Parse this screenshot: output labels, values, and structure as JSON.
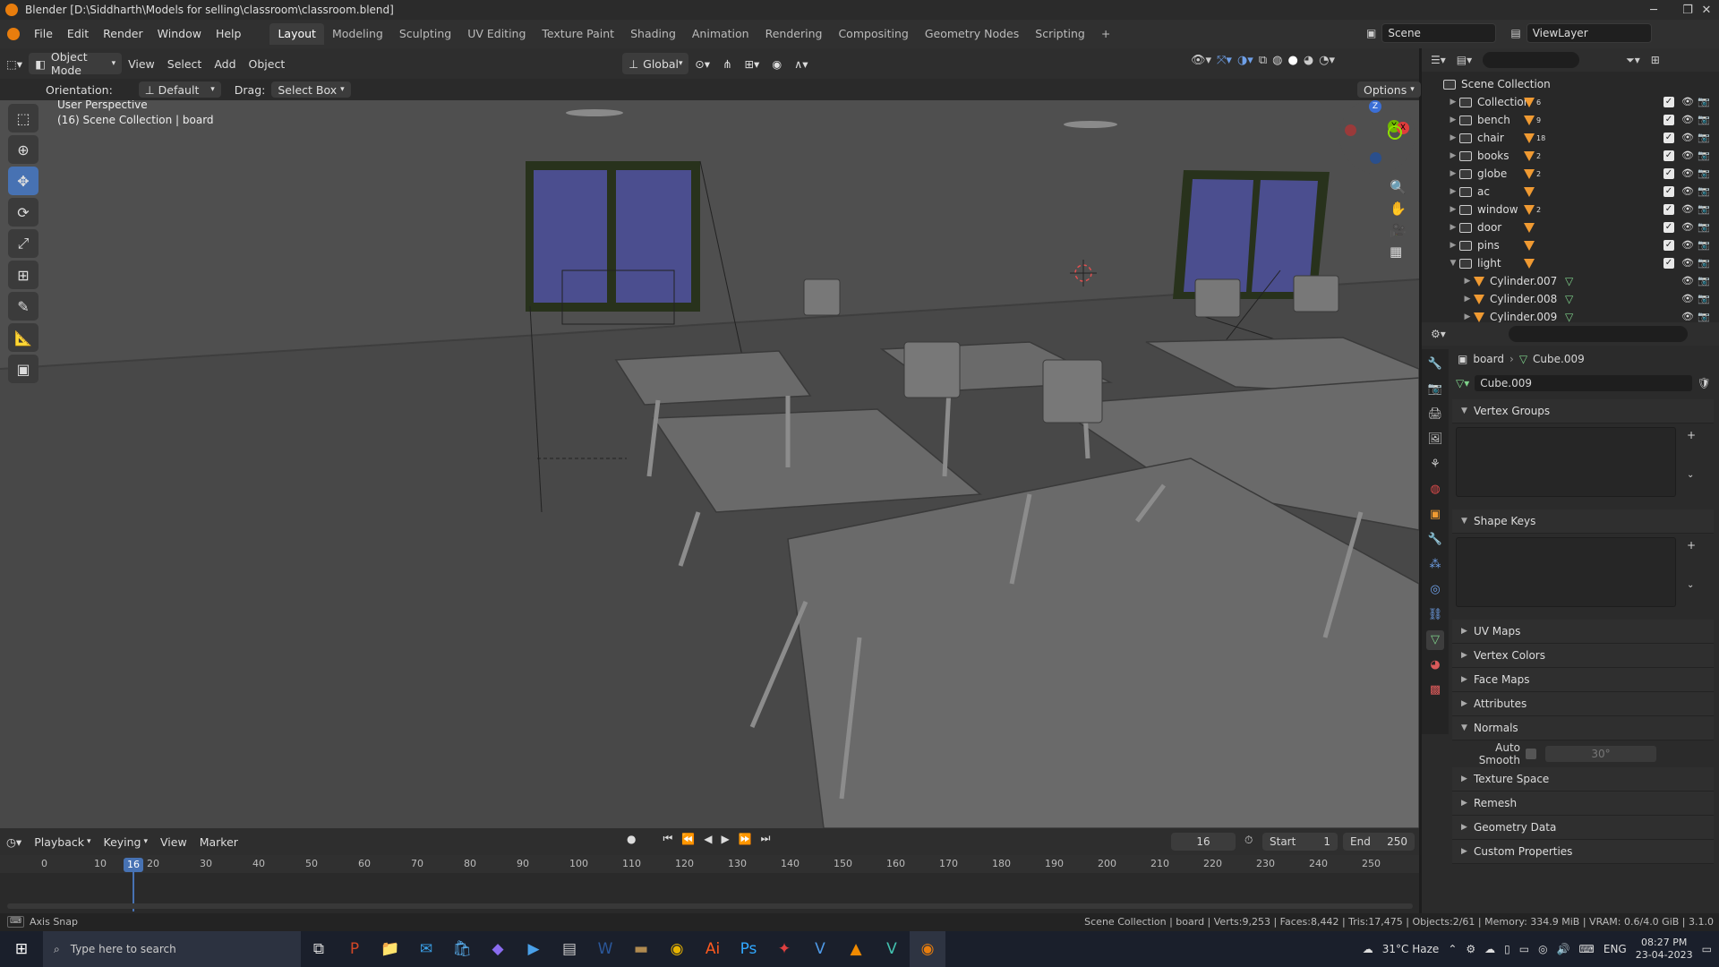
{
  "title_bar": {
    "title": "Blender [D:\\Siddharth\\Models for selling\\classroom\\classroom.blend]"
  },
  "menu": {
    "items": [
      "File",
      "Edit",
      "Render",
      "Window",
      "Help"
    ]
  },
  "workspaces": {
    "tabs": [
      "Layout",
      "Modeling",
      "Sculpting",
      "UV Editing",
      "Texture Paint",
      "Shading",
      "Animation",
      "Rendering",
      "Compositing",
      "Geometry Nodes",
      "Scripting"
    ],
    "active": "Layout",
    "add": "+"
  },
  "scene": {
    "scene_name": "Scene",
    "view_layer": "ViewLayer"
  },
  "viewport_header": {
    "mode": "Object Mode",
    "menus": [
      "View",
      "Select",
      "Add",
      "Object"
    ],
    "transform": "Global",
    "orientation_label": "Orientation:",
    "orientation_value": "Default",
    "drag_label": "Drag:",
    "drag_value": "Select Box",
    "options": "Options"
  },
  "viewport": {
    "perspective": "User Perspective",
    "context": "(16) Scene Collection | board",
    "gizmo": {
      "z": "Z",
      "y": "Y",
      "x": "X"
    }
  },
  "outliner": {
    "root": "Scene Collection",
    "rows": [
      {
        "name": "Collection",
        "count": "6"
      },
      {
        "name": "bench",
        "count": "9"
      },
      {
        "name": "chair",
        "count": "18"
      },
      {
        "name": "books",
        "count": "2"
      },
      {
        "name": "globe",
        "count": "2"
      },
      {
        "name": "ac",
        "count": ""
      },
      {
        "name": "window",
        "count": "2"
      },
      {
        "name": "door",
        "count": ""
      },
      {
        "name": "pins",
        "count": ""
      },
      {
        "name": "light",
        "count": ""
      }
    ],
    "children": [
      "Cylinder.007",
      "Cylinder.008",
      "Cylinder.009"
    ]
  },
  "properties": {
    "breadcrumb_object": "board",
    "breadcrumb_data": "Cube.009",
    "data_name": "Cube.009",
    "sections": {
      "vertex_groups": "Vertex Groups",
      "shape_keys": "Shape Keys",
      "uv_maps": "UV Maps",
      "vertex_colors": "Vertex Colors",
      "face_maps": "Face Maps",
      "attributes": "Attributes",
      "normals": "Normals",
      "auto_smooth": "Auto Smooth",
      "auto_smooth_angle": "30°",
      "texture_space": "Texture Space",
      "remesh": "Remesh",
      "geometry_data": "Geometry Data",
      "custom_properties": "Custom Properties"
    }
  },
  "timeline": {
    "menus": [
      "Playback",
      "Keying",
      "View",
      "Marker"
    ],
    "current_frame": "16",
    "start_label": "Start",
    "start": "1",
    "end_label": "End",
    "end": "250",
    "ticks": [
      "0",
      "10",
      "20",
      "30",
      "40",
      "50",
      "60",
      "70",
      "80",
      "90",
      "100",
      "110",
      "120",
      "130",
      "140",
      "150",
      "160",
      "170",
      "180",
      "190",
      "200",
      "210",
      "220",
      "230",
      "240",
      "250"
    ],
    "frame_marker": "16"
  },
  "status_bar": {
    "left": "Axis Snap",
    "right": "Scene Collection | board | Verts:9,253 | Faces:8,442 | Tris:17,475 | Objects:2/61 | Memory: 334.9 MiB | VRAM: 0.6/4.0 GiB | 3.1.0"
  },
  "taskbar": {
    "search_placeholder": "Type here to search",
    "weather": "31°C  Haze",
    "language": "ENG",
    "time": "08:27 PM",
    "date": "23-04-2023"
  },
  "colors": {
    "accent": "#4772b3",
    "orange": "#e87d0d",
    "viewport_bg": "#4a4a4a",
    "window_glass": "#4b4e8f"
  }
}
